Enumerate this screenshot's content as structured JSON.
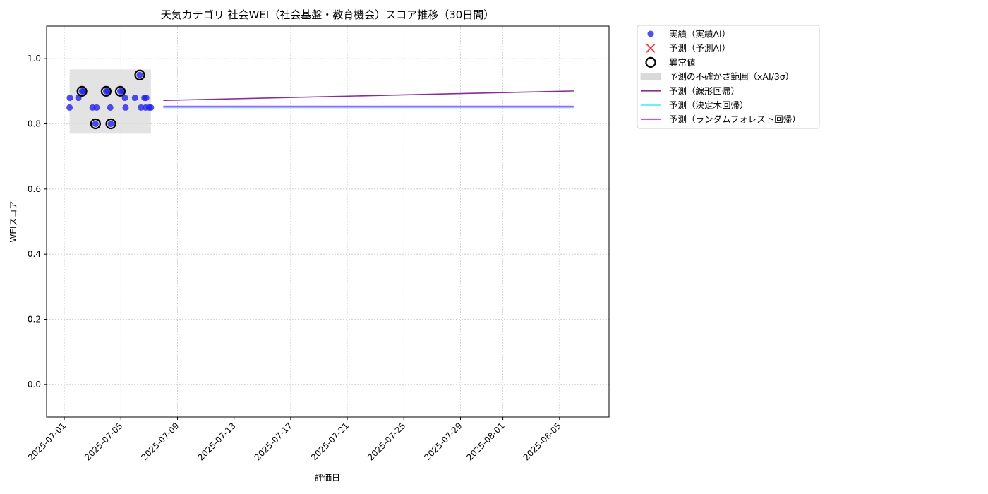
{
  "chart_data": {
    "type": "scatter",
    "title": "天気カテゴリ 社会WEI（社会基盤・教育機会）スコア推移（30日間）",
    "xlabel": "評価日",
    "ylabel": "WEIスコア",
    "xlim": [
      "2025-06-29T18:00",
      "2025-08-08T12:00"
    ],
    "ylim": [
      -0.1,
      1.1
    ],
    "x_ticks": [
      "2025-07-01",
      "2025-07-05",
      "2025-07-09",
      "2025-07-13",
      "2025-07-17",
      "2025-07-21",
      "2025-07-25",
      "2025-07-29",
      "2025-08-01",
      "2025-08-05"
    ],
    "y_ticks": [
      0.0,
      0.2,
      0.4,
      0.6,
      0.8,
      1.0
    ],
    "y_tick_labels": [
      "0.0",
      "0.2",
      "0.4",
      "0.6",
      "0.8",
      "1.0"
    ],
    "grid": true,
    "legend_position": "outside-top-right",
    "actual": {
      "name": "実績（実績AI）",
      "color": "#2222ee",
      "points": [
        {
          "x": "2025-07-01T09:00",
          "y": 0.85
        },
        {
          "x": "2025-07-01T09:30",
          "y": 0.88
        },
        {
          "x": "2025-07-02T00:00",
          "y": 0.88
        },
        {
          "x": "2025-07-02T06:00",
          "y": 0.9
        },
        {
          "x": "2025-07-02T09:00",
          "y": 0.9
        },
        {
          "x": "2025-07-03T00:00",
          "y": 0.85
        },
        {
          "x": "2025-07-03T05:00",
          "y": 0.8
        },
        {
          "x": "2025-07-03T07:00",
          "y": 0.85
        },
        {
          "x": "2025-07-03T23:00",
          "y": 0.9
        },
        {
          "x": "2025-07-04T02:00",
          "y": 0.9
        },
        {
          "x": "2025-07-04T06:00",
          "y": 0.85
        },
        {
          "x": "2025-07-04T07:00",
          "y": 0.8
        },
        {
          "x": "2025-07-04T23:00",
          "y": 0.9
        },
        {
          "x": "2025-07-05T03:00",
          "y": 0.9
        },
        {
          "x": "2025-07-05T08:00",
          "y": 0.85
        },
        {
          "x": "2025-07-05T07:00",
          "y": 0.88
        },
        {
          "x": "2025-07-06T00:00",
          "y": 0.88
        },
        {
          "x": "2025-07-06T08:00",
          "y": 0.95
        },
        {
          "x": "2025-07-06T10:00",
          "y": 0.85
        },
        {
          "x": "2025-07-06T16:00",
          "y": 0.88
        },
        {
          "x": "2025-07-06T18:00",
          "y": 0.85
        },
        {
          "x": "2025-07-06T19:00",
          "y": 0.88
        },
        {
          "x": "2025-07-07T00:00",
          "y": 0.85
        },
        {
          "x": "2025-07-07T03:00",
          "y": 0.85
        }
      ]
    },
    "anomalies": {
      "name": "異常値",
      "color": "#000000",
      "points": [
        {
          "x": "2025-07-02T06:00",
          "y": 0.9
        },
        {
          "x": "2025-07-03T05:00",
          "y": 0.8
        },
        {
          "x": "2025-07-03T23:00",
          "y": 0.9
        },
        {
          "x": "2025-07-04T07:00",
          "y": 0.8
        },
        {
          "x": "2025-07-04T23:00",
          "y": 0.9
        },
        {
          "x": "2025-07-06T08:00",
          "y": 0.95
        }
      ]
    },
    "prediction_marker": {
      "name": "予測（予測AI）",
      "color": "#ff3333"
    },
    "uncertainty_band": {
      "name": "予測の不確かさ範囲（xAI/3σ）",
      "color": "#d9d9d9",
      "x_start": "2025-07-01T09:00",
      "x_end": "2025-07-07T03:00",
      "y_low": 0.77,
      "y_high": 0.967
    },
    "series": [
      {
        "name": "予測（線形回帰）",
        "color": "#8b2a9b",
        "x": [
          "2025-07-08T00:00",
          "2025-08-06T00:00"
        ],
        "y": [
          0.872,
          0.901
        ]
      },
      {
        "name": "予測（決定木回帰）",
        "color": "#33eeff",
        "x": [
          "2025-07-08T00:00",
          "2025-08-06T00:00"
        ],
        "y": [
          0.85,
          0.85
        ]
      },
      {
        "name": "予測（ランダムフォレスト回帰）",
        "color": "#ff33ff",
        "x": [
          "2025-07-08T00:00",
          "2025-08-06T00:00"
        ],
        "y": [
          0.854,
          0.854
        ]
      }
    ]
  }
}
